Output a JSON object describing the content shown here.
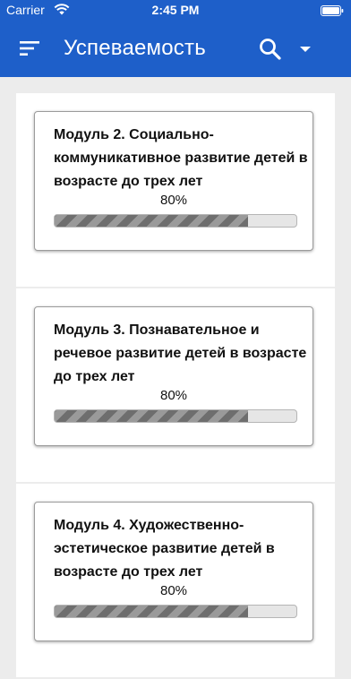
{
  "status_bar": {
    "carrier": "Carrier",
    "time": "2:45 PM"
  },
  "app_bar": {
    "title": "Успеваемость"
  },
  "modules": [
    {
      "title": "Модуль 2. Социально-коммуникативное развитие детей в возрасте до трех лет",
      "progress_label": "80%",
      "progress": 0.8
    },
    {
      "title": "Модуль 3. Познавательное и речевое развитие детей в возрасте до трех лет",
      "progress_label": "80%",
      "progress": 0.8
    },
    {
      "title": "Модуль 4. Художественно-эстетическое развитие детей в возрасте до трех лет",
      "progress_label": "80%",
      "progress": 0.8
    }
  ]
}
